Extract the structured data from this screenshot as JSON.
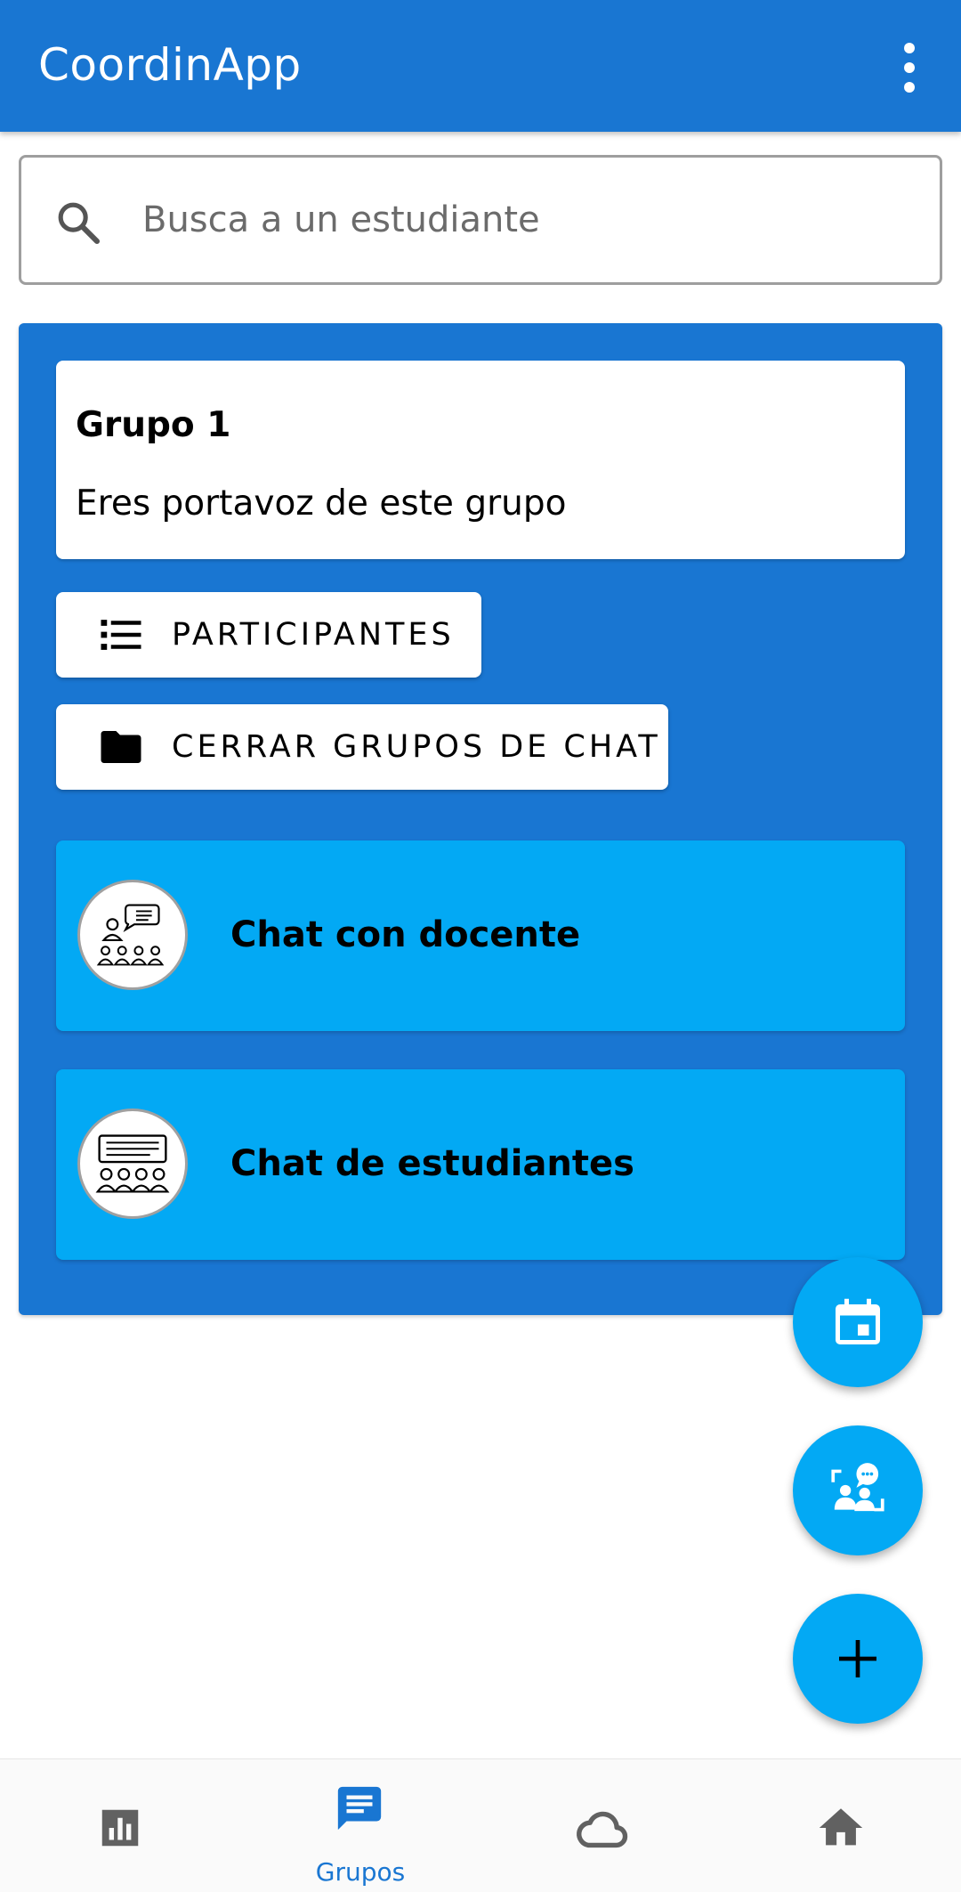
{
  "app": {
    "title": "CoordinApp"
  },
  "search": {
    "placeholder": "Busca a un estudiante",
    "value": ""
  },
  "group": {
    "title": "Grupo 1",
    "subtitle": "Eres portavoz de este grupo",
    "participants_label": "PARTICIPANTES",
    "close_chats_label": "CERRAR GRUPOS DE CHAT"
  },
  "chats": [
    {
      "label": "Chat con docente",
      "icon": "teacher-class-icon"
    },
    {
      "label": "Chat de estudiantes",
      "icon": "students-class-icon"
    }
  ],
  "fabs": [
    {
      "icon": "calendar-icon"
    },
    {
      "icon": "meeting-chat-icon"
    },
    {
      "icon": "add-icon"
    }
  ],
  "bottom_nav": {
    "items": [
      {
        "icon": "bar-chart-icon",
        "label": ""
      },
      {
        "icon": "chat-icon",
        "label": "Grupos",
        "selected": true
      },
      {
        "icon": "cloud-icon",
        "label": ""
      },
      {
        "icon": "home-icon",
        "label": ""
      }
    ]
  },
  "colors": {
    "primary": "#1976d2",
    "accent": "#03a9f4",
    "nav_inactive": "#616161"
  }
}
